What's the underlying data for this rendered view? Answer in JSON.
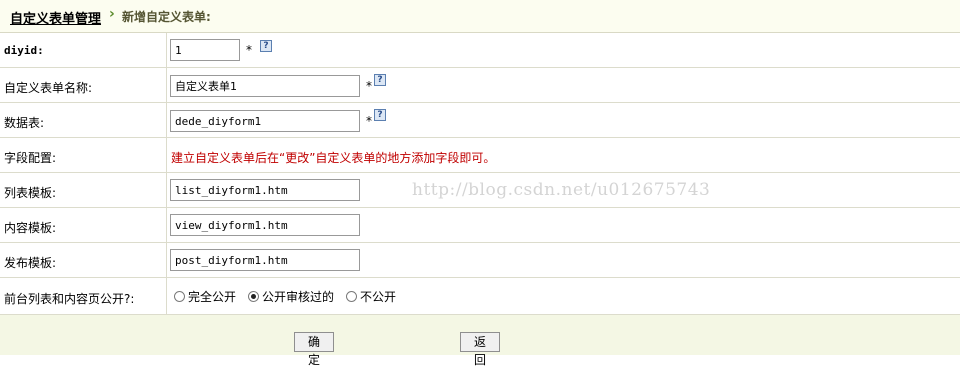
{
  "breadcrumb": {
    "root": "自定义表单管理",
    "separator": "›",
    "current": "新增自定义表单:"
  },
  "fields": {
    "diyid": {
      "label": "diyid:",
      "value": "1",
      "required_mark": "*"
    },
    "name": {
      "label": "自定义表单名称:",
      "value": "自定义表单1",
      "required_mark": "*"
    },
    "table": {
      "label": "数据表:",
      "value": "dede_diyform1",
      "required_mark": "*"
    },
    "fields_config": {
      "label": "字段配置:",
      "note": "建立自定义表单后在“更改”自定义表单的地方添加字段即可。"
    },
    "list_template": {
      "label": "列表模板:",
      "value": "list_diyform1.htm"
    },
    "content_template": {
      "label": "内容模板:",
      "value": "view_diyform1.htm"
    },
    "post_template": {
      "label": "发布模板:",
      "value": "post_diyform1.htm"
    },
    "public": {
      "label": "前台列表和内容页公开?:",
      "options": [
        "完全公开",
        "公开审核过的",
        "不公开"
      ],
      "selected": "公开审核过的"
    }
  },
  "icons": {
    "help": "help-icon"
  },
  "buttons": {
    "confirm": "确定",
    "back": "返回"
  },
  "watermark": "http://blog.csdn.net/u012675743"
}
